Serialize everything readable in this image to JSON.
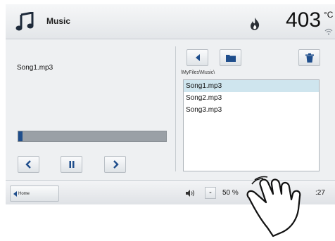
{
  "header": {
    "title": "Music",
    "temperature": "403",
    "temperature_unit": "°C",
    "icons": [
      "music-note-icon",
      "flame-icon",
      "wifi-icon"
    ]
  },
  "player": {
    "current_song": "Song1.mp3",
    "progress_fraction": 0.03,
    "controls": {
      "prev": "<",
      "pause": "II",
      "next": ">"
    }
  },
  "browser": {
    "path": "\\MyFiles\\Music\\",
    "files": [
      "Song1.mp3",
      "Song2.mp3",
      "Song3.mp3"
    ],
    "selected_index": 0,
    "toolbar_icons": [
      "back-arrow-icon",
      "folder-icon",
      "trash-icon"
    ]
  },
  "footer": {
    "home_label": "Home",
    "volume_minus": "-",
    "volume": "50 %",
    "clock_partial": ":27"
  },
  "colors": {
    "accent": "#1f4e8c",
    "selection": "#cfe5ee",
    "background": "#eef0f2"
  }
}
